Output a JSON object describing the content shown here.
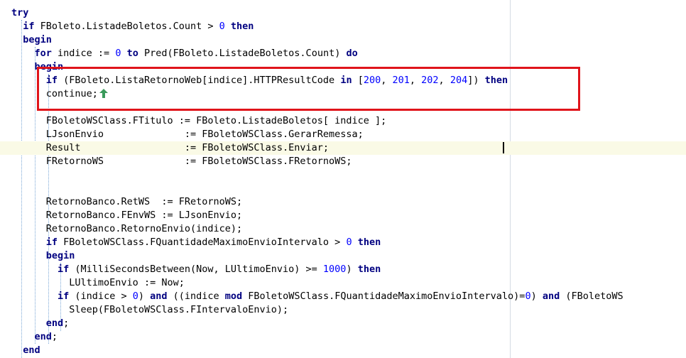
{
  "editor": {
    "lines": [
      {
        "indent": "",
        "tokens": [
          {
            "t": "kw",
            "v": "try"
          }
        ]
      },
      {
        "indent": "  ",
        "tokens": [
          {
            "t": "kw",
            "v": "if"
          },
          {
            "t": "sym",
            "v": " FBoleto.ListadeBoletos.Count > "
          },
          {
            "t": "num",
            "v": "0"
          },
          {
            "t": "sym",
            "v": " "
          },
          {
            "t": "kw",
            "v": "then"
          }
        ]
      },
      {
        "indent": "  ",
        "tokens": [
          {
            "t": "kw",
            "v": "begin"
          }
        ]
      },
      {
        "indent": "    ",
        "tokens": [
          {
            "t": "kw",
            "v": "for"
          },
          {
            "t": "sym",
            "v": " indice := "
          },
          {
            "t": "num",
            "v": "0"
          },
          {
            "t": "sym",
            "v": " "
          },
          {
            "t": "kw",
            "v": "to"
          },
          {
            "t": "sym",
            "v": " Pred(FBoleto.ListadeBoletos.Count) "
          },
          {
            "t": "kw",
            "v": "do"
          }
        ]
      },
      {
        "indent": "    ",
        "tokens": [
          {
            "t": "kw",
            "v": "begin"
          }
        ]
      },
      {
        "indent": "      ",
        "tokens": [
          {
            "t": "kw",
            "v": "if"
          },
          {
            "t": "sym",
            "v": " (FBoleto.ListaRetornoWeb[indice].HTTPResultCode "
          },
          {
            "t": "kw",
            "v": "in"
          },
          {
            "t": "sym",
            "v": " ["
          },
          {
            "t": "num",
            "v": "200"
          },
          {
            "t": "sym",
            "v": ", "
          },
          {
            "t": "num",
            "v": "201"
          },
          {
            "t": "sym",
            "v": ", "
          },
          {
            "t": "num",
            "v": "202"
          },
          {
            "t": "sym",
            "v": ", "
          },
          {
            "t": "num",
            "v": "204"
          },
          {
            "t": "sym",
            "v": "]) "
          },
          {
            "t": "kw",
            "v": "then"
          }
        ]
      },
      {
        "indent": "      ",
        "tokens": [
          {
            "t": "sym",
            "v": "continue;"
          }
        ],
        "marker": "green-up-arrow-icon"
      },
      {
        "indent": "",
        "tokens": []
      },
      {
        "indent": "      ",
        "tokens": [
          {
            "t": "sym",
            "v": "FBoletoWSClass.FTitulo := FBoleto.ListadeBoletos[ indice ];"
          }
        ]
      },
      {
        "indent": "      ",
        "tokens": [
          {
            "t": "sym",
            "v": "LJsonEnvio              := FBoletoWSClass.GerarRemessa;"
          }
        ]
      },
      {
        "indent": "      ",
        "tokens": [
          {
            "t": "sym",
            "v": "Result                  := FBoletoWSClass.Enviar;"
          }
        ],
        "current": true
      },
      {
        "indent": "      ",
        "tokens": [
          {
            "t": "sym",
            "v": "FRetornoWS              := FBoletoWSClass.FRetornoWS;"
          }
        ]
      },
      {
        "indent": "",
        "tokens": []
      },
      {
        "indent": "",
        "tokens": []
      },
      {
        "indent": "      ",
        "tokens": [
          {
            "t": "sym",
            "v": "RetornoBanco.RetWS  := FRetornoWS;"
          }
        ]
      },
      {
        "indent": "      ",
        "tokens": [
          {
            "t": "sym",
            "v": "RetornoBanco.FEnvWS := LJsonEnvio;"
          }
        ]
      },
      {
        "indent": "      ",
        "tokens": [
          {
            "t": "sym",
            "v": "RetornoBanco.RetornoEnvio(indice);"
          }
        ]
      },
      {
        "indent": "      ",
        "tokens": [
          {
            "t": "kw",
            "v": "if"
          },
          {
            "t": "sym",
            "v": " FBoletoWSClass.FQuantidadeMaximoEnvioIntervalo > "
          },
          {
            "t": "num",
            "v": "0"
          },
          {
            "t": "sym",
            "v": " "
          },
          {
            "t": "kw",
            "v": "then"
          }
        ]
      },
      {
        "indent": "      ",
        "tokens": [
          {
            "t": "kw",
            "v": "begin"
          }
        ]
      },
      {
        "indent": "        ",
        "tokens": [
          {
            "t": "kw",
            "v": "if"
          },
          {
            "t": "sym",
            "v": " (MilliSecondsBetween(Now, LUltimoEnvio) >= "
          },
          {
            "t": "num",
            "v": "1000"
          },
          {
            "t": "sym",
            "v": ") "
          },
          {
            "t": "kw",
            "v": "then"
          }
        ]
      },
      {
        "indent": "          ",
        "tokens": [
          {
            "t": "sym",
            "v": "LUltimoEnvio := Now;"
          }
        ]
      },
      {
        "indent": "        ",
        "tokens": [
          {
            "t": "kw",
            "v": "if"
          },
          {
            "t": "sym",
            "v": " (indice > "
          },
          {
            "t": "num",
            "v": "0"
          },
          {
            "t": "sym",
            "v": ") "
          },
          {
            "t": "kw",
            "v": "and"
          },
          {
            "t": "sym",
            "v": " ((indice "
          },
          {
            "t": "kw",
            "v": "mod"
          },
          {
            "t": "sym",
            "v": " FBoletoWSClass.FQuantidadeMaximoEnvioIntervalo)="
          },
          {
            "t": "num",
            "v": "0"
          },
          {
            "t": "sym",
            "v": ") "
          },
          {
            "t": "kw",
            "v": "and"
          },
          {
            "t": "sym",
            "v": " (FBoletoWS"
          }
        ]
      },
      {
        "indent": "          ",
        "tokens": [
          {
            "t": "sym",
            "v": "Sleep(FBoletoWSClass.FIntervaloEnvio);"
          }
        ]
      },
      {
        "indent": "      ",
        "tokens": [
          {
            "t": "kw",
            "v": "end"
          },
          {
            "t": "sym",
            "v": ";"
          }
        ]
      },
      {
        "indent": "    ",
        "tokens": [
          {
            "t": "kw",
            "v": "end"
          },
          {
            "t": "sym",
            "v": ";"
          }
        ]
      },
      {
        "indent": "  ",
        "tokens": [
          {
            "t": "kw",
            "v": "end"
          }
        ]
      }
    ]
  },
  "colors": {
    "keyword": "#000080",
    "number": "#0000ff",
    "highlight_box": "#e0141b",
    "current_line": "#fafae6",
    "marker_arrow": "#3a9a5a"
  }
}
